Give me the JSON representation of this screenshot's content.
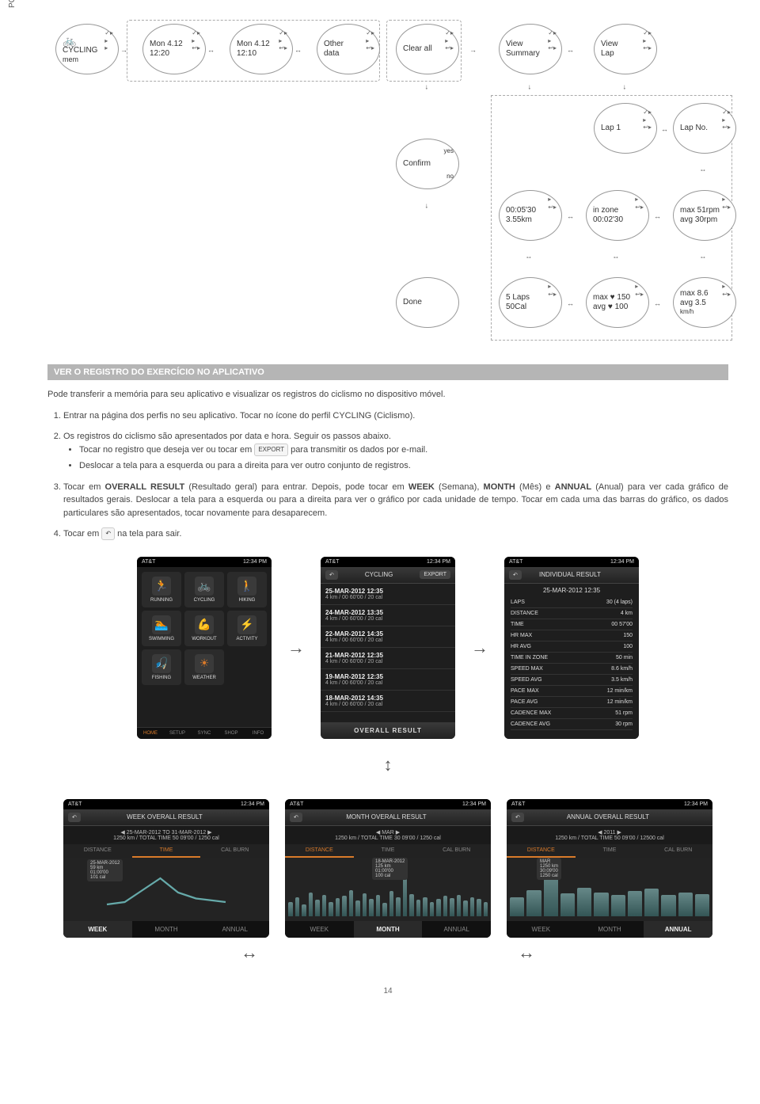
{
  "page_label": "POR",
  "page_number": "14",
  "diagram": {
    "n_cycling_l1": "CYCLING",
    "n_cycling_l2": "mem",
    "n_mon1_l1": "Mon 4.12",
    "n_mon1_l2": "12:20",
    "n_mon2_l1": "Mon 4.12",
    "n_mon2_l2": "12:10",
    "n_other_l1": "Other",
    "n_other_l2": "data",
    "n_clearall": "Clear all",
    "n_viewsum_l1": "View",
    "n_viewsum_l2": "Summary",
    "n_viewlap_l1": "View",
    "n_viewlap_l2": "Lap",
    "n_lap1": "Lap 1",
    "n_lapno": "Lap No.",
    "n_confirm": "Confirm",
    "n_confirm_yes": "yes",
    "n_confirm_no": "no",
    "n_done": "Done",
    "n_dist_l1": "00:05'30",
    "n_dist_l2": "3.55km",
    "n_zone_l1": "in zone",
    "n_zone_l2": "00:02'30",
    "n_rpm_l1": "max 51rpm",
    "n_rpm_l2": "avg 30rpm",
    "n_laps_l1": "5 Laps",
    "n_laps_l2": "50Cal",
    "n_hr_l1": "max ♥ 150",
    "n_hr_l2": "avg ♥ 100",
    "n_speed_l1": "max 8.6",
    "n_speed_l2": "avg 3.5",
    "n_speed_l3": "km/h"
  },
  "section_title": "VER O REGISTRO DO EXERCÍCIO NO APLICATIVO",
  "intro": "Pode transferir a memória para seu aplicativo e visualizar os registros do ciclismo no dispositivo móvel.",
  "step1": "Entrar na página dos perfis no seu aplicativo. Tocar no ícone do perfil CYCLING (Ciclismo).",
  "step2": "Os registros do ciclismo são apresentados por data e hora. Seguir os passos abaixo.",
  "step2_b1a": "Tocar no registro que deseja ver ou tocar em",
  "step2_b1_icon": "EXPORT",
  "step2_b1b": "para transmitir os dados por e-mail.",
  "step2_b2": "Deslocar a tela para a esquerda ou para a direita para ver outro conjunto de registros.",
  "step3": "Tocar em OVERALL RESULT (Resultado geral) para entrar. Depois, pode tocar em WEEK (Semana), MONTH (Mês) e ANNUAL (Anual) para ver cada gráfico de resultados gerais. Deslocar a tela para a esquerda ou para a direita para ver o gráfico por cada unidade de tempo. Tocar em cada uma das barras do gráfico, os dados particulares são apresentados, tocar novamente para desaparecem.",
  "step4a": "Tocar em",
  "step4b": "na tela para sair.",
  "screens": {
    "status_left": "AT&T",
    "status_time": "12:34 PM",
    "s1": {
      "cells": [
        "RUNNING",
        "CYCLING",
        "HIKING",
        "SWIMMING",
        "WORKOUT",
        "ACTIVITY",
        "FISHING",
        "WEATHER"
      ],
      "tabs": [
        "HOME",
        "SETUP",
        "SYNC",
        "SHOP",
        "INFO"
      ]
    },
    "s2": {
      "title": "CYCLING",
      "btn": "EXPORT",
      "rows": [
        {
          "t1": "25-MAR-2012 12:35",
          "t2": "4 km / 00 60'00 / 20 cal"
        },
        {
          "t1": "24-MAR-2012 13:35",
          "t2": "4 km / 00 60'00 / 20 cal"
        },
        {
          "t1": "22-MAR-2012 14:35",
          "t2": "4 km / 00 60'00 / 20 cal"
        },
        {
          "t1": "21-MAR-2012 12:35",
          "t2": "4 km / 00 60'00 / 20 cal"
        },
        {
          "t1": "19-MAR-2012 12:35",
          "t2": "4 km / 00 60'00 / 20 cal"
        },
        {
          "t1": "18-MAR-2012 14:35",
          "t2": "4 km / 00 60'00 / 20 cal"
        }
      ],
      "overall": "OVERALL RESULT"
    },
    "s3": {
      "title": "INDIVIDUAL RESULT",
      "date": "25-MAR-2012 12:35",
      "rows": [
        {
          "k": "LAPS",
          "v": "30 (4 laps)"
        },
        {
          "k": "DISTANCE",
          "v": "4 km"
        },
        {
          "k": "TIME",
          "v": "00 57'00"
        },
        {
          "k": "HR MAX",
          "v": "150"
        },
        {
          "k": "HR AVG",
          "v": "100"
        },
        {
          "k": "TIME IN ZONE",
          "v": "50 min"
        },
        {
          "k": "SPEED MAX",
          "v": "8.6 km/h"
        },
        {
          "k": "SPEED AVG",
          "v": "3.5 km/h"
        },
        {
          "k": "PACE MAX",
          "v": "12 min/km"
        },
        {
          "k": "PACE AVG",
          "v": "12 min/km"
        },
        {
          "k": "CADENCE MAX",
          "v": "51 rpm"
        },
        {
          "k": "CADENCE AVG",
          "v": "30 rpm"
        }
      ]
    },
    "c1": {
      "title": "WEEK OVERALL RESULT",
      "sub": "25-MAR-2012 TO 31-MAR-2012",
      "sub2": "1250 km / TOTAL TIME 50 09'00 / 1250 cal",
      "tabs": [
        "DISTANCE",
        "TIME",
        "CAL BURN"
      ],
      "periods": [
        "WEEK",
        "MONTH",
        "ANNUAL"
      ],
      "peak": "25-MAR-2012\n59 km\n01:00'00\n101 cal"
    },
    "c2": {
      "title": "MONTH OVERALL RESULT",
      "sub": "MAR",
      "sub2": "1250 km / TOTAL TIME 30 09'00 / 1250 cal",
      "tabs": [
        "DISTANCE",
        "TIME",
        "CAL BURN"
      ],
      "periods": [
        "WEEK",
        "MONTH",
        "ANNUAL"
      ],
      "peak": "18-MAR-2012\n125 km\n01:00'00\n100 cal"
    },
    "c3": {
      "title": "ANNUAL OVERALL RESULT",
      "sub": "2011",
      "sub2": "1250 km / TOTAL TIME 50 09'00 / 12500 cal",
      "tabs": [
        "DISTANCE",
        "TIME",
        "CAL BURN"
      ],
      "periods": [
        "WEEK",
        "MONTH",
        "ANNUAL"
      ],
      "peak": "MAR\n1250 km\n30:09'00\n1250 cal"
    }
  }
}
